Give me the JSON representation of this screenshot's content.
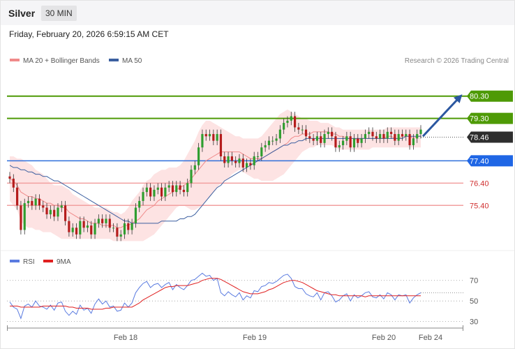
{
  "header": {
    "title": "Silver",
    "timeframe": "30 MIN"
  },
  "datetime": "Friday, February 20, 2026 6:59:15 AM CET",
  "chart_data": [
    {
      "type": "candlestick",
      "legend": [
        {
          "label": "MA 20 + Bollinger Bands",
          "color": "#f08a8a"
        },
        {
          "label": "MA 50",
          "color": "#3b5fa0"
        }
      ],
      "credit": "Research © 2026 Trading Central",
      "ylim": [
        73.5,
        81.7
      ],
      "current_price": {
        "label": "78.46",
        "value": 78.46
      },
      "levels": [
        {
          "label": "80.30",
          "value": 80.3,
          "kind": "resistance"
        },
        {
          "label": "79.30",
          "value": 79.3,
          "kind": "resistance"
        },
        {
          "label": "77.40",
          "value": 77.4,
          "kind": "pivot"
        },
        {
          "label": "76.40",
          "value": 76.4,
          "kind": "support"
        },
        {
          "label": "75.40",
          "value": 75.4,
          "kind": "support"
        }
      ],
      "forecast_arrow": {
        "from": 78.5,
        "to": 80.3
      },
      "x_ticks": [
        "Feb 18",
        "Feb 19",
        "Feb 20",
        "Feb 24"
      ],
      "closes": [
        76.6,
        76.2,
        75.4,
        74.3,
        75.5,
        75.6,
        75.4,
        75.7,
        75.4,
        75.3,
        75.0,
        75.2,
        74.9,
        75.3,
        75.4,
        74.7,
        74.2,
        74.4,
        74.1,
        74.7,
        74.4,
        74.5,
        74.1,
        74.6,
        74.8,
        74.6,
        74.8,
        74.4,
        74.4,
        74.0,
        74.1,
        74.6,
        74.3,
        74.6,
        75.3,
        75.6,
        76.0,
        76.2,
        75.8,
        76.1,
        76.2,
        75.8,
        76.2,
        76.3,
        76.0,
        76.3,
        76.1,
        76.0,
        76.4,
        77.0,
        77.2,
        78.0,
        78.6,
        78.5,
        78.6,
        78.3,
        78.6,
        77.6,
        77.3,
        77.6,
        77.4,
        77.3,
        77.5,
        77.1,
        77.3,
        77.2,
        77.6,
        77.6,
        78.0,
        78.1,
        78.3,
        78.3,
        78.4,
        78.8,
        79.1,
        79.2,
        79.4,
        78.9,
        78.8,
        78.8,
        78.5,
        78.4,
        78.3,
        78.5,
        78.2,
        78.6,
        78.7,
        78.5,
        78.0,
        78.1,
        78.3,
        78.5,
        78.0,
        78.4,
        78.2,
        78.4,
        78.6,
        78.7,
        78.5,
        78.4,
        78.6,
        78.4,
        78.7,
        78.6,
        78.3,
        78.6,
        78.5,
        78.6,
        78.1,
        78.4,
        78.6,
        78.8
      ],
      "ma20": [
        76.6,
        76.5,
        76.3,
        76.0,
        75.9,
        75.8,
        75.8,
        75.7,
        75.7,
        75.6,
        75.5,
        75.5,
        75.4,
        75.4,
        75.3,
        75.3,
        75.1,
        75.0,
        74.9,
        74.8,
        74.8,
        74.7,
        74.6,
        74.6,
        74.6,
        74.5,
        74.5,
        74.5,
        74.5,
        74.4,
        74.4,
        74.5,
        74.5,
        74.6,
        74.7,
        74.8,
        75.0,
        75.2,
        75.3,
        75.4,
        75.6,
        75.7,
        75.8,
        75.9,
        76.0,
        76.1,
        76.2,
        76.3,
        76.4,
        76.6,
        76.8,
        77.0,
        77.2,
        77.4,
        77.5,
        77.6,
        77.7,
        77.8,
        77.8,
        77.8,
        77.8,
        77.8,
        77.8,
        77.7,
        77.6,
        77.5,
        77.5,
        77.5,
        77.5,
        77.6,
        77.7,
        77.8,
        77.9,
        78.0,
        78.1,
        78.2,
        78.4,
        78.5,
        78.5,
        78.6,
        78.6,
        78.6,
        78.7,
        78.7,
        78.7,
        78.7,
        78.7,
        78.6,
        78.6,
        78.5,
        78.5,
        78.4,
        78.4,
        78.4,
        78.3,
        78.4,
        78.4,
        78.4,
        78.4,
        78.4,
        78.4,
        78.4,
        78.5,
        78.5,
        78.4,
        78.4,
        78.5,
        78.5,
        78.5,
        78.4,
        78.5,
        78.5
      ],
      "bb_upper": [
        77.6,
        77.6,
        77.5,
        77.5,
        77.4,
        77.3,
        77.2,
        77.0,
        76.9,
        76.8,
        76.6,
        76.4,
        76.3,
        76.3,
        76.3,
        76.2,
        76.1,
        75.9,
        75.8,
        75.7,
        75.6,
        75.5,
        75.4,
        75.3,
        75.3,
        75.3,
        75.3,
        75.2,
        75.1,
        75.1,
        75.0,
        75.1,
        75.3,
        75.6,
        75.8,
        76.0,
        76.3,
        76.5,
        76.6,
        76.8,
        76.9,
        77.0,
        77.0,
        77.1,
        77.1,
        77.1,
        77.2,
        77.4,
        77.7,
        78.0,
        78.3,
        78.7,
        79.0,
        79.2,
        79.2,
        79.1,
        79.0,
        78.9,
        78.8,
        78.7,
        78.6,
        78.5,
        78.5,
        78.4,
        78.4,
        78.4,
        78.4,
        78.4,
        78.5,
        78.7,
        78.9,
        79.1,
        79.3,
        79.5,
        79.6,
        79.7,
        79.6,
        79.5,
        79.4,
        79.3,
        79.3,
        79.2,
        79.2,
        79.2,
        79.1,
        79.1,
        79.1,
        79.0,
        78.9,
        78.9,
        78.8,
        78.8,
        78.8,
        78.8,
        78.8,
        78.8,
        78.8,
        78.8,
        78.8,
        78.8,
        78.8,
        78.8,
        78.9,
        78.9,
        78.9,
        78.9,
        78.9,
        78.9,
        78.9,
        78.9,
        78.9,
        78.9
      ],
      "bb_lower": [
        75.6,
        75.4,
        75.2,
        74.7,
        74.5,
        74.4,
        74.4,
        74.3,
        74.3,
        74.2,
        74.2,
        74.2,
        74.1,
        74.0,
        73.9,
        73.9,
        73.9,
        73.9,
        73.9,
        73.9,
        73.9,
        73.9,
        73.9,
        73.9,
        73.9,
        73.9,
        73.9,
        73.9,
        73.8,
        73.8,
        73.8,
        73.8,
        73.8,
        73.8,
        73.8,
        73.8,
        73.8,
        73.9,
        74.0,
        74.1,
        74.3,
        74.5,
        74.7,
        74.9,
        75.1,
        75.3,
        75.4,
        75.4,
        75.3,
        75.2,
        75.2,
        75.3,
        75.4,
        75.6,
        75.8,
        76.0,
        76.2,
        76.4,
        76.5,
        76.6,
        76.8,
        76.9,
        77.0,
        76.9,
        76.8,
        76.7,
        76.6,
        76.6,
        76.5,
        76.5,
        76.5,
        76.5,
        76.6,
        76.7,
        76.8,
        77.0,
        77.2,
        77.4,
        77.6,
        77.8,
        77.9,
        78.0,
        78.0,
        78.1,
        78.1,
        78.1,
        78.1,
        78.1,
        78.0,
        77.9,
        77.9,
        77.9,
        77.9,
        77.9,
        77.9,
        77.9,
        77.9,
        77.9,
        78.0,
        78.0,
        78.0,
        78.0,
        78.0,
        78.0,
        78.0,
        78.0,
        78.0,
        78.0,
        78.0,
        78.0,
        78.0,
        78.0
      ],
      "ma50": [
        77.2,
        77.1,
        77.1,
        77.0,
        77.0,
        76.9,
        76.9,
        76.8,
        76.8,
        76.7,
        76.7,
        76.6,
        76.5,
        76.5,
        76.4,
        76.3,
        76.2,
        76.1,
        76.0,
        75.9,
        75.8,
        75.7,
        75.6,
        75.5,
        75.4,
        75.3,
        75.2,
        75.1,
        75.0,
        74.9,
        74.8,
        74.7,
        74.7,
        74.6,
        74.6,
        74.6,
        74.6,
        74.6,
        74.6,
        74.6,
        74.6,
        74.7,
        74.7,
        74.7,
        74.7,
        74.7,
        74.8,
        74.8,
        74.9,
        74.9,
        75.0,
        75.2,
        75.4,
        75.6,
        75.8,
        76.0,
        76.2,
        76.3,
        76.5,
        76.6,
        76.7,
        76.8,
        76.9,
        77.0,
        77.1,
        77.2,
        77.3,
        77.4,
        77.5,
        77.6,
        77.7,
        77.8,
        77.9,
        78.0,
        78.1,
        78.1,
        78.2,
        78.2,
        78.3,
        78.3,
        78.4,
        78.4,
        78.4,
        78.4,
        78.4,
        78.4,
        78.4,
        78.4,
        78.4,
        78.4,
        78.4,
        78.4,
        78.4,
        78.4,
        78.4,
        78.4,
        78.4,
        78.4,
        78.4,
        78.4,
        78.4,
        78.4,
        78.4,
        78.4,
        78.4,
        78.4,
        78.4,
        78.5,
        78.5,
        78.5,
        78.5,
        78.5
      ]
    },
    {
      "type": "line",
      "legend": [
        {
          "label": "RSI",
          "color": "#5a7be0"
        },
        {
          "label": "9MA",
          "color": "#e02020"
        }
      ],
      "ylim": [
        25,
        80
      ],
      "y_ticks": [
        "70",
        "50",
        "30"
      ],
      "series": [
        {
          "name": "RSI",
          "values": [
            49,
            44,
            42,
            33,
            45,
            47,
            44,
            50,
            45,
            44,
            42,
            46,
            41,
            48,
            49,
            40,
            36,
            40,
            37,
            46,
            41,
            43,
            38,
            47,
            52,
            47,
            50,
            44,
            45,
            40,
            41,
            48,
            44,
            48,
            58,
            63,
            67,
            69,
            63,
            66,
            67,
            63,
            66,
            68,
            61,
            66,
            63,
            61,
            65,
            70,
            71,
            74,
            77,
            74,
            75,
            70,
            72,
            58,
            55,
            59,
            56,
            54,
            58,
            51,
            55,
            53,
            60,
            59,
            64,
            65,
            68,
            67,
            69,
            72,
            75,
            76,
            72,
            64,
            62,
            62,
            57,
            55,
            54,
            58,
            51,
            58,
            59,
            55,
            49,
            51,
            55,
            57,
            50,
            56,
            53,
            55,
            58,
            59,
            54,
            53,
            56,
            52,
            58,
            56,
            51,
            56,
            55,
            56,
            48,
            53,
            56,
            58
          ]
        },
        {
          "name": "9MA",
          "values": [
            45,
            45,
            45,
            44,
            44,
            44,
            44,
            44,
            44,
            45,
            45,
            45,
            45,
            45,
            45,
            45,
            44,
            44,
            43,
            43,
            43,
            43,
            42,
            42,
            42,
            42,
            43,
            43,
            44,
            44,
            44,
            44,
            44,
            44,
            46,
            48,
            51,
            53,
            55,
            57,
            59,
            61,
            63,
            64,
            64,
            65,
            65,
            65,
            65,
            66,
            67,
            68,
            70,
            71,
            72,
            72,
            72,
            71,
            69,
            67,
            65,
            63,
            61,
            59,
            58,
            57,
            57,
            57,
            58,
            59,
            61,
            62,
            64,
            66,
            68,
            69,
            70,
            70,
            69,
            68,
            66,
            64,
            62,
            60,
            59,
            58,
            57,
            56,
            56,
            55,
            55,
            55,
            55,
            55,
            55,
            55,
            54,
            55,
            55,
            55,
            55,
            55,
            55,
            55,
            55,
            55,
            55,
            55,
            55,
            55,
            55,
            55
          ]
        }
      ]
    }
  ]
}
